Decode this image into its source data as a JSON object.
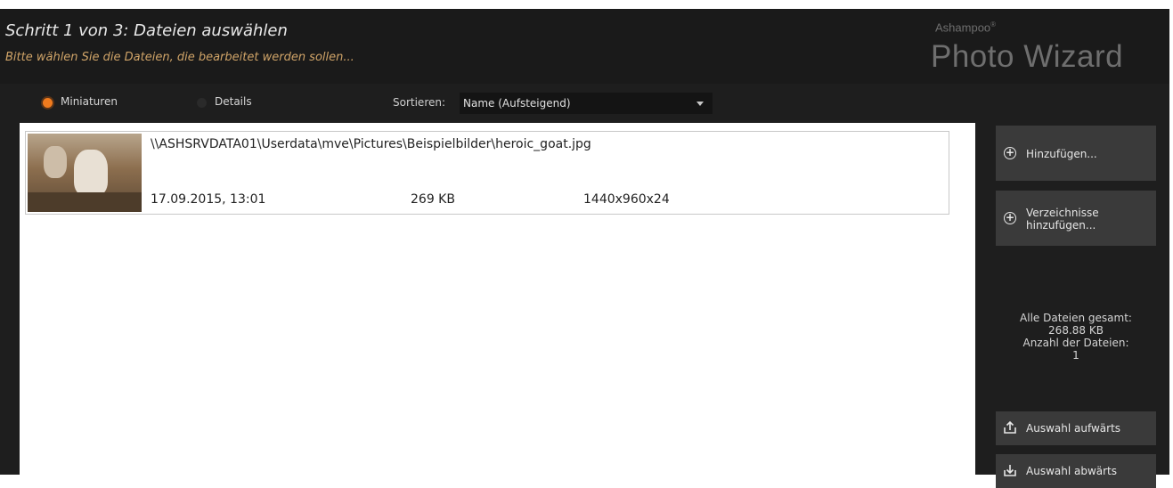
{
  "header": {
    "title": "Schritt 1 von 3: Dateien auswählen",
    "subtitle": "Bitte wählen Sie die Dateien, die bearbeitet werden sollen...",
    "brand_small": "Ashampoo",
    "brand_reg": "®",
    "brand_big": "Photo Wizard"
  },
  "view": {
    "option_thumbnails": "Miniaturen",
    "option_details": "Details",
    "selected": "Miniaturen",
    "sort_label": "Sortieren:",
    "sort_value": "Name (Aufsteigend)"
  },
  "files": [
    {
      "path": "\\\\ASHSRVDATA01\\Userdata\\mve\\Pictures\\Beispielbilder\\heroic_goat.jpg",
      "date": "17.09.2015, 13:01",
      "size": "269 KB",
      "dimensions": "1440x960x24"
    }
  ],
  "sidebar": {
    "add_label": "Hinzufügen...",
    "add_dirs_label": "Verzeichnisse\nhinzufügen...",
    "stats_total_label": "Alle Dateien gesamt:",
    "stats_total_value": "268.88 KB",
    "stats_count_label": "Anzahl der Dateien:",
    "stats_count_value": "1",
    "move_up_label": "Auswahl aufwärts",
    "move_down_label": "Auswahl abwärts"
  },
  "colors": {
    "accent": "#f07b1e",
    "subtitle": "#d0a468",
    "background": "#1e1e1e",
    "button": "#3a3a3a"
  }
}
